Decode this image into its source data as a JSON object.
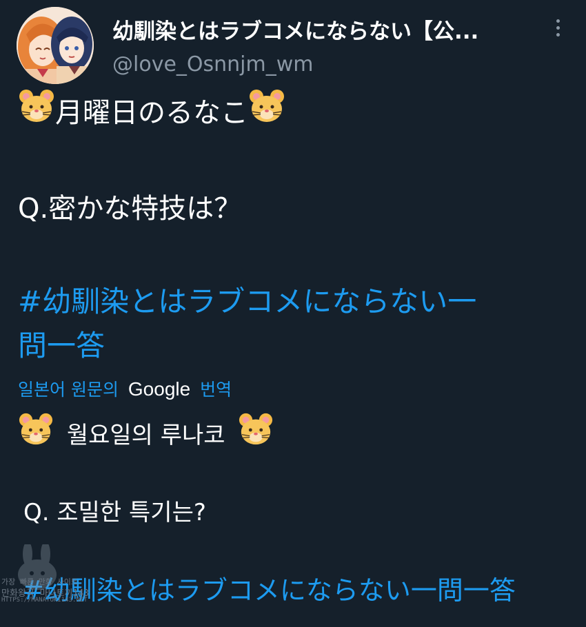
{
  "tweet": {
    "display_name": "幼馴染とはラブコメにならない【公...",
    "handle": "@love_Osnnjm_wm",
    "original": {
      "line1": "月曜日のるなこ",
      "line2": "Q.密かな特技は？",
      "hashtag_line1": "#幼馴染とはラブコメにならない一",
      "hashtag_line2": "問一答"
    },
    "translation_bar": {
      "prefix": "일본어 원문의",
      "brand": "Google",
      "suffix": "번역"
    },
    "translated": {
      "line1": "월요일의 루나코",
      "line2": "Q. 조밀한 특기는?",
      "hashtag": "#幼馴染とはラブコメにならない一問一答"
    }
  },
  "icons": {
    "more": "more-vertical-icon",
    "emoji": "hamster-face-icon"
  },
  "colors": {
    "background": "#15202b",
    "link": "#1d9bf0",
    "secondary_text": "#8b98a5"
  },
  "watermark": {
    "line1": "가장 빠른 만화 사이트",
    "line2": "만화왕국 마나토끼143",
    "line3": "HTTPS://MANATOKI143.NET"
  }
}
